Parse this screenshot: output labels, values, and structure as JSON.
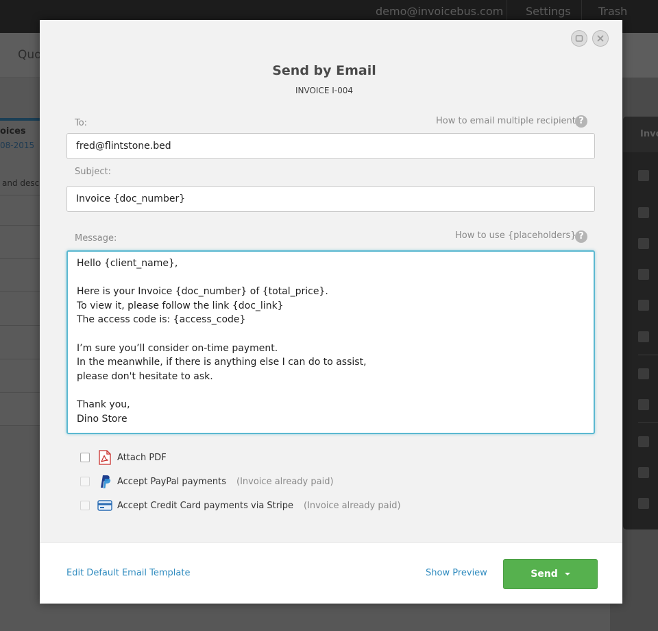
{
  "background_app": {
    "topbar": {
      "user_email": "demo@invoicebus.com",
      "settings_label": "Settings",
      "trash_label": "Trash"
    },
    "header_fragment": "Quo",
    "left_panel": {
      "title_fragment": "oices",
      "date_fragment": "08-2015",
      "desc_fragment": "and desc"
    },
    "right_panel": {
      "title_fragment": "Invo"
    }
  },
  "modal": {
    "title": "Send by Email",
    "subtitle": "INVOICE I-004",
    "to": {
      "label": "To:",
      "value": "fred@flintstone.bed",
      "help_text": "How to email multiple recipients"
    },
    "subject": {
      "label": "Subject:",
      "value": "Invoice {doc_number}"
    },
    "message": {
      "label": "Message:",
      "help_text": "How to use {placeholders}",
      "lines": [
        "Hello {client_name},",
        "",
        "Here is your Invoice {doc_number} of {total_price}.",
        "To view it, please follow the link {doc_link}",
        "The access code is: {access_code}",
        "",
        "I’m sure you’ll consider on-time payment.",
        "In the meanwhile, if there is anything else I can do to assist,",
        "please don't hesitate to ask.",
        "",
        "Thank you,",
        "Dino Store"
      ]
    },
    "options": {
      "attach_pdf": {
        "label": "Attach PDF",
        "checked": false,
        "enabled": true,
        "icon": "pdf-icon"
      },
      "paypal": {
        "label": "Accept PayPal payments",
        "note": "(Invoice already paid)",
        "checked": false,
        "enabled": false,
        "icon": "paypal-icon"
      },
      "stripe": {
        "label": "Accept Credit Card payments via Stripe",
        "note": "(Invoice already paid)",
        "checked": false,
        "enabled": false,
        "icon": "credit-card-icon"
      }
    },
    "footer": {
      "edit_template_label": "Edit Default Email Template",
      "preview_label": "Show Preview",
      "send_label": "Send"
    }
  },
  "colors": {
    "accent_blue": "#5bb8d0",
    "link_blue": "#2f8bbf",
    "send_green": "#56b14e"
  }
}
